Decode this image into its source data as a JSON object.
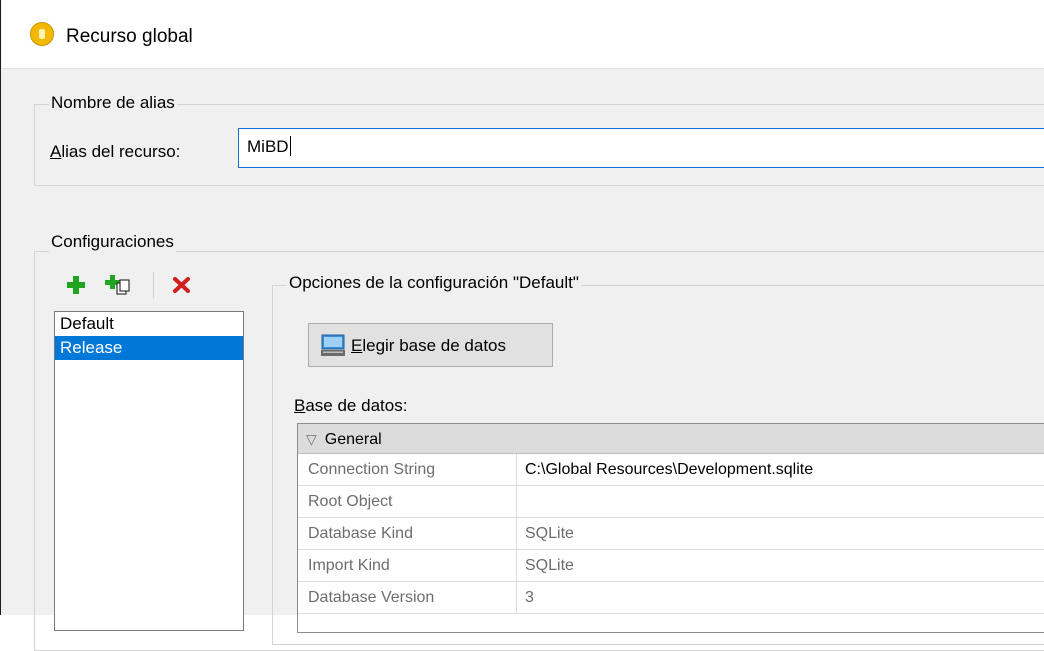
{
  "window": {
    "title": "Recurso global"
  },
  "alias_group": {
    "legend": "Nombre de alias",
    "label_mnemonic": "A",
    "label_rest": "lias del recurso:",
    "value": "MiBD"
  },
  "config_group": {
    "legend": "Configuraciones",
    "toolbar": {
      "add_icon": "plus-icon",
      "copy_icon": "add-copy-icon",
      "delete_icon": "delete-x-icon"
    },
    "items": [
      {
        "label": "Default",
        "selected": false
      },
      {
        "label": "Release",
        "selected": true
      }
    ]
  },
  "options_group": {
    "legend": "Opciones de la configuración \"Default\"",
    "choose_button": {
      "mnemonic": "E",
      "rest": "legir base de datos",
      "icon": "database-icon"
    },
    "db_label_mnemonic": "B",
    "db_label_rest": "ase de datos:",
    "grid": {
      "section": "General",
      "rows": [
        {
          "name": "Connection String",
          "value": "C:\\Global Resources\\Development.sqlite"
        },
        {
          "name": "Root Object",
          "value": ""
        },
        {
          "name": "Database Kind",
          "value": "SQLite"
        },
        {
          "name": "Import Kind",
          "value": "SQLite"
        },
        {
          "name": "Database Version",
          "value": "3"
        }
      ]
    }
  },
  "colors": {
    "selection": "#0078d7",
    "focus_border": "#1a6fd6"
  }
}
